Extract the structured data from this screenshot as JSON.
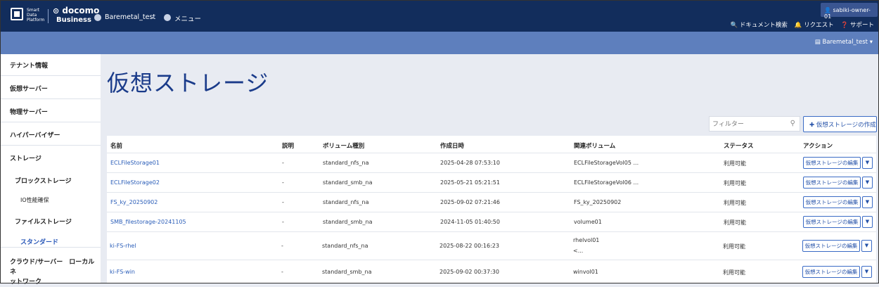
{
  "header": {
    "logo_lines": [
      "Smart",
      "Data",
      "Platform"
    ],
    "brand_top": "docomo",
    "brand_bottom": "Business",
    "breadcrumbs": [
      "Baremetal_test",
      "メニュー"
    ],
    "user": "sabiki-owner-01",
    "links": [
      "ドキュメント検索",
      "リクエスト",
      "サポート"
    ],
    "tenant": "Baremetal_test"
  },
  "sidebar": {
    "items": [
      "テナント情報",
      "仮想サーバー",
      "物理サーバー",
      "ハイパーバイザー",
      "ストレージ"
    ],
    "storage_children": [
      "ブロックストレージ",
      "IO性能確保",
      "ファイルストレージ",
      "スタンダード"
    ],
    "last_item": [
      "クラウド/サーバー　ローカルネ",
      "ットワーク"
    ]
  },
  "main": {
    "title": "仮想ストレージ",
    "filter_placeholder": "フィルター",
    "create_button": "仮想ストレージの作成",
    "columns": [
      "名前",
      "説明",
      "ボリューム種別",
      "作成日時",
      "関連ボリューム",
      "ステータス",
      "アクション"
    ],
    "edit_label": "仮想ストレージの編集",
    "rows": [
      {
        "name": "ECLFileStorage01",
        "desc": "-",
        "type": "standard_nfs_na",
        "created": "2025-04-28 07:53:10",
        "volume": "ECLFileStorageVol05 ...",
        "volume2": "",
        "status": "利用可能"
      },
      {
        "name": "ECLFileStorage02",
        "desc": "-",
        "type": "standard_smb_na",
        "created": "2025-05-21 05:21:51",
        "volume": "ECLFileStorageVol06 ...",
        "volume2": "",
        "status": "利用可能"
      },
      {
        "name": "FS_ky_20250902",
        "desc": "-",
        "type": "standard_nfs_na",
        "created": "2025-09-02 07:21:46",
        "volume": "FS_ky_20250902",
        "volume2": "",
        "status": "利用可能"
      },
      {
        "name": "SMB_filestorage-20241105",
        "desc": "-",
        "type": "standard_smb_na",
        "created": "2024-11-05 01:40:50",
        "volume": "volume01",
        "volume2": "",
        "status": "利用可能"
      },
      {
        "name": "ki-FS-rhel",
        "desc": "-",
        "type": "standard_nfs_na",
        "created": "2025-08-22 00:16:23",
        "volume": "rhelvol01",
        "volume2": "<...",
        "status": "利用可能"
      },
      {
        "name": "ki-FS-win",
        "desc": "-",
        "type": "standard_smb_na",
        "created": "2025-09-02 00:37:30",
        "volume": "winvol01",
        "volume2": "",
        "status": "利用可能"
      }
    ]
  }
}
